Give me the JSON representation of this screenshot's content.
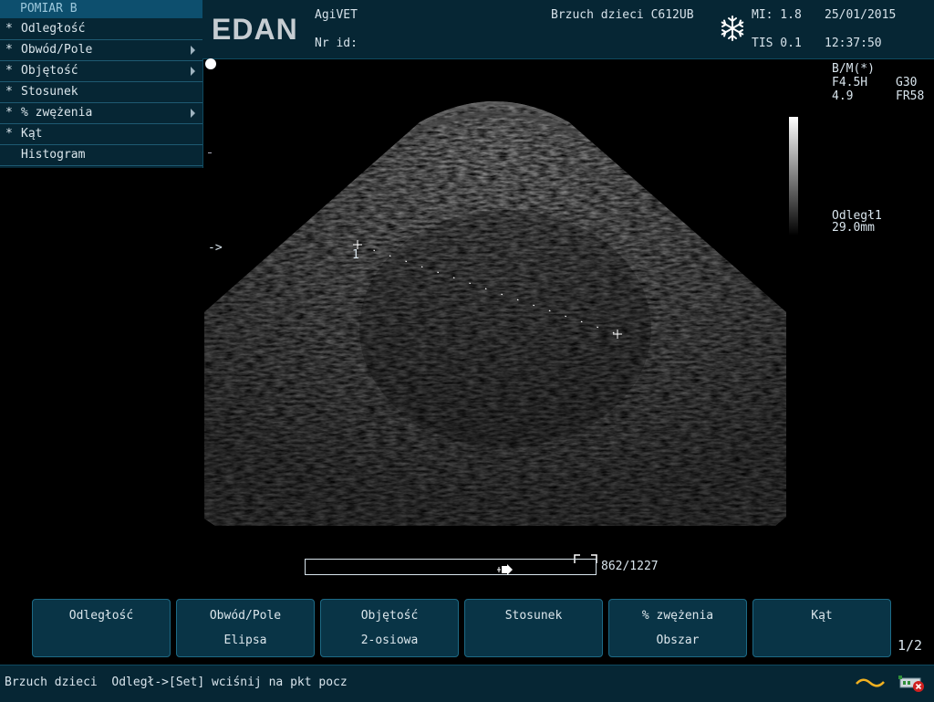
{
  "menu": {
    "title": "POMIAR B",
    "items": [
      {
        "marker": "*",
        "label": "Odległość",
        "submenu": false
      },
      {
        "marker": "*",
        "label": "Obwód/Pole",
        "submenu": true
      },
      {
        "marker": "*",
        "label": "Objętość",
        "submenu": true
      },
      {
        "marker": "*",
        "label": "Stosunek",
        "submenu": false
      },
      {
        "marker": "*",
        "label": "% zwężenia",
        "submenu": true
      },
      {
        "marker": "*",
        "label": "Kąt",
        "submenu": false
      },
      {
        "marker": "",
        "label": "Histogram",
        "submenu": false
      }
    ]
  },
  "header": {
    "logo": "EDAN",
    "hospital": "AgiVET",
    "patient_id_label": "Nr id:",
    "exam": "Brzuch dzieci C612UB",
    "mi": "MI: 1.8",
    "tis": "TIS 0.1",
    "date": "25/01/2015",
    "time": "12:37:50"
  },
  "image_params": {
    "mode": "B/M(*)",
    "freq": "F4.5H",
    "gain": "G30",
    "depth": "4.9",
    "framerate": "FR58"
  },
  "measurement": {
    "label": "Odległ1",
    "value": "29.0mm",
    "marker_number": "1",
    "focus_marker": "->"
  },
  "cine": {
    "counter": "862/1227",
    "position": 0.7
  },
  "softkeys": [
    {
      "line1": "Odległość",
      "line2": ""
    },
    {
      "line1": "Obwód/Pole",
      "line2": "Elipsa"
    },
    {
      "line1": "Objętość",
      "line2": "2-osiowa"
    },
    {
      "line1": "Stosunek",
      "line2": ""
    },
    {
      "line1": "% zwężenia",
      "line2": "Obszar"
    },
    {
      "line1": "Kąt",
      "line2": ""
    }
  ],
  "page_indicator": "1/2",
  "status": {
    "text": "Brzuch dzieci  Odległ->[Set] wciśnij na pkt pocz"
  },
  "colors": {
    "panel": "#062634",
    "accent": "#0d4f6e",
    "border": "#1d6a86"
  }
}
